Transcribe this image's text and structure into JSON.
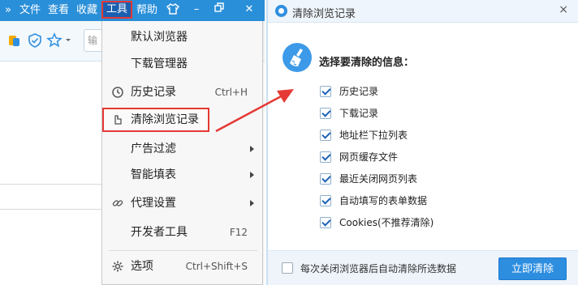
{
  "browser": {
    "menubar": [
      {
        "label": "文件"
      },
      {
        "label": "查看"
      },
      {
        "label": "收藏"
      },
      {
        "label": "工具",
        "active": true
      },
      {
        "label": "帮助"
      }
    ],
    "window_controls": [
      "minimize-icon",
      "restore-icon",
      "close-icon"
    ],
    "address_fragment": "输",
    "colors": {
      "titlebar": "#2a8fd9",
      "highlight_outline": "#e53935"
    }
  },
  "tools_menu": {
    "items": [
      {
        "label": "默认浏览器",
        "icon": null,
        "shortcut": "",
        "submenu": false
      },
      {
        "label": "下载管理器",
        "icon": null,
        "shortcut": "",
        "submenu": false
      },
      {
        "label": "历史记录",
        "icon": "clock-icon",
        "shortcut": "Ctrl+H",
        "submenu": false
      },
      {
        "label": "清除浏览记录 ...",
        "icon": "clear-icon",
        "shortcut": "",
        "submenu": false,
        "highlighted": true
      },
      {
        "label": "广告过滤",
        "icon": null,
        "shortcut": "",
        "submenu": true
      },
      {
        "label": "智能填表",
        "icon": null,
        "shortcut": "",
        "submenu": true
      },
      {
        "label": "代理设置",
        "icon": "link-icon",
        "shortcut": "",
        "submenu": true
      },
      {
        "label": "开发者工具",
        "icon": null,
        "shortcut": "F12",
        "submenu": false
      },
      {
        "label": "选项",
        "icon": "gear-icon",
        "shortcut": "Ctrl+Shift+S",
        "submenu": false
      }
    ]
  },
  "dialog": {
    "title": "清除浏览记录",
    "close_symbol": "×",
    "prompt": "选择要清除的信息：",
    "options": [
      {
        "label": "历史记录",
        "checked": true
      },
      {
        "label": "下载记录",
        "checked": true
      },
      {
        "label": "地址栏下拉列表",
        "checked": true
      },
      {
        "label": "网页缓存文件",
        "checked": true
      },
      {
        "label": "最近关闭网页列表",
        "checked": true
      },
      {
        "label": "自动填写的表单数据",
        "checked": true
      },
      {
        "label": "Cookies(不推荐清除)",
        "checked": true
      }
    ],
    "footer": {
      "auto_clear_label": "每次关闭浏览器后自动清除所选数据",
      "auto_clear_checked": false,
      "primary_button": "立即清除"
    },
    "colors": {
      "accent": "#2d8ee0",
      "footer_bg": "#eef4fa"
    }
  }
}
